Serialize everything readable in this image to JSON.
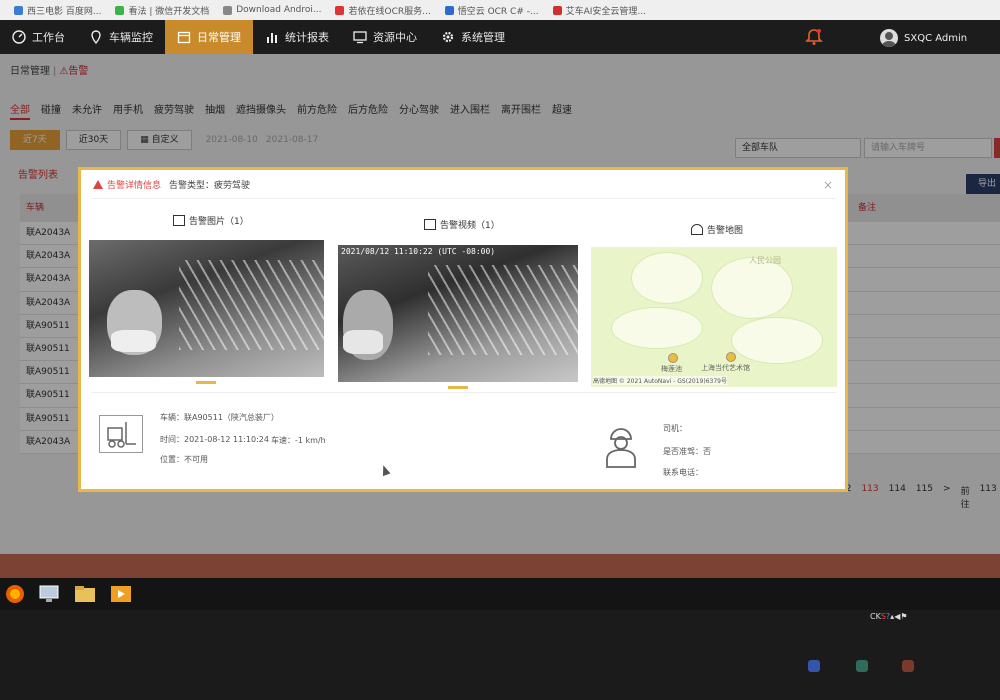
{
  "bookmarks": [
    {
      "label": "西三电影 百度网...",
      "color": "#3a7bd5"
    },
    {
      "label": "看法 | 微信开发文档",
      "color": "#3bb34a"
    },
    {
      "label": "Download Androi...",
      "color": "#888888"
    },
    {
      "label": "若依在线OCR服务...",
      "color": "#d33333"
    },
    {
      "label": "悟空云 OCR C# -...",
      "color": "#2d6bd0"
    },
    {
      "label": "艾车AI安全云管理...",
      "color": "#d03030"
    }
  ],
  "nav": {
    "items": [
      {
        "label": "工作台",
        "icon": "dashboard-icon"
      },
      {
        "label": "车辆监控",
        "icon": "location-pin-icon"
      },
      {
        "label": "日常管理",
        "icon": "calendar-icon",
        "active": true
      },
      {
        "label": "统计报表",
        "icon": "bar-chart-icon"
      },
      {
        "label": "资源中心",
        "icon": "monitor-icon"
      },
      {
        "label": "系统管理",
        "icon": "gear-icon"
      }
    ],
    "user": "SXQC Admin"
  },
  "breadcrumb": {
    "parent": "日常管理",
    "separator": "|",
    "current": "告警"
  },
  "filters": [
    "全部",
    "碰撞",
    "未允许",
    "用手机",
    "疲劳驾驶",
    "抽烟",
    "遮挡摄像头",
    "前方危险",
    "后方危险",
    "分心驾驶",
    "进入围栏",
    "离开围栏",
    "超速"
  ],
  "date_buttons": [
    "近7天",
    "近30天",
    "自定义"
  ],
  "date_range": {
    "start": "2021-08-10",
    "end": "2021-08-17"
  },
  "vehicle_select": "全部车队",
  "plate_placeholder": "请输入车牌号",
  "list_title": "告警列表",
  "export_label": "导出",
  "table": {
    "col_plate": "车辆",
    "col_remark": "备注",
    "rows": [
      "联A2043A",
      "联A2043A",
      "联A2043A",
      "联A2043A",
      "联A90511",
      "联A90511",
      "联A90511",
      "联A90511",
      "联A90511",
      "联A2043A"
    ]
  },
  "pager": [
    "12",
    "113",
    "114",
    "115",
    ">",
    "前往",
    "113"
  ],
  "modal": {
    "title": "告警详情信息",
    "type_label": "告警类型：",
    "type_value": "疲劳驾驶",
    "tab_photos": "告警图片（1）",
    "tab_video": "告警视频（1）",
    "tab_map": "告警地图",
    "video_timestamp": "2021/08/12 11:10:22 (UTC -08:00)",
    "map_labels": {
      "park": "人民公园",
      "poi1": "梅莲池",
      "poi2": "上海当代艺术馆",
      "footer": "高德地图 © 2021 AutoNavi - GS(2019)6379号"
    },
    "vehicle": "车辆：联A90511（陕汽总装厂）",
    "time": "时间：2021-08-12 11:10:24",
    "speed": "车速：-1 km/h",
    "location": "位置：不可用",
    "driver": "司机：",
    "registered": "是否准驾：否",
    "phone": "联系电话："
  },
  "colors": {
    "accent": "#c98a2c",
    "alert": "#d44444",
    "modal_border": "#e6b84a",
    "nav_bg": "#1c1c1c"
  }
}
